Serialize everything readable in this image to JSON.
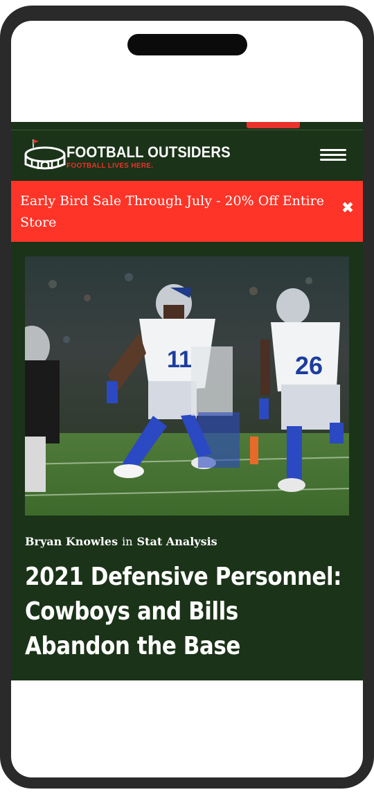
{
  "site": {
    "name": "FOOTBALL OUTSIDERS",
    "tagline": "FOOTBALL LIVES HERE.",
    "brand_green": "#1b3318",
    "accent_red": "#ff3428"
  },
  "header": {
    "menu_icon": "hamburger-menu-icon"
  },
  "banner": {
    "text": "Early Bird Sale Through July - 20% Off Entire Store",
    "close_icon": "close-icon",
    "close_glyph": "✖"
  },
  "hero_image": {
    "alt": "Dallas Cowboys defenders #11 and #26 on the field"
  },
  "article": {
    "author": "Bryan Knowles",
    "connector": "in",
    "category": "Stat Analysis",
    "title": "2021 Defensive Personnel: Cowboys and Bills Abandon the Base"
  }
}
